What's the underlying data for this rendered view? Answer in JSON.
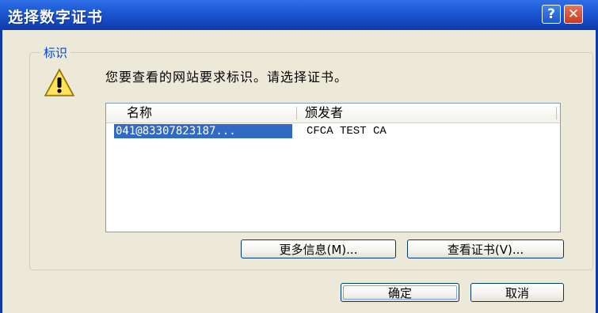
{
  "window": {
    "title": "选择数字证书",
    "help_glyph": "?",
    "close_glyph": "✕"
  },
  "group": {
    "label": "标识",
    "message": "您要查看的网站要求标识。请选择证书。",
    "icon": "warning-icon"
  },
  "list": {
    "columns": [
      "名称",
      "颁发者"
    ],
    "rows": [
      {
        "name": "041@83307823187...",
        "issuer": "CFCA TEST CA",
        "selected": true
      }
    ]
  },
  "buttons": {
    "more_info": "更多信息(M)...",
    "view_cert": "查看证书(V)...",
    "ok": "确定",
    "cancel": "取消"
  },
  "colors": {
    "titlebar": "#1e5bd6",
    "selection": "#316ac5",
    "group_label": "#0046d5",
    "dialog_bg": "#ece9d8"
  }
}
